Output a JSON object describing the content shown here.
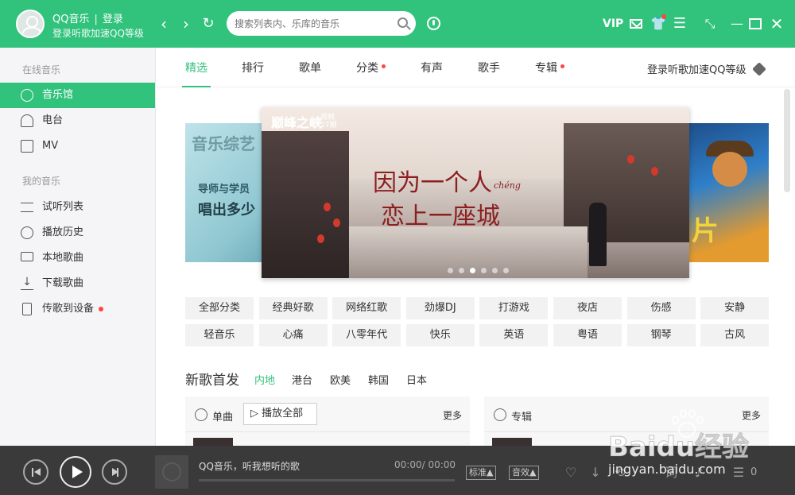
{
  "header": {
    "app_name": "QQ音乐",
    "separator": "|",
    "login_label": "登录",
    "sub_text": "登录听歌加速QQ等级",
    "back_glyph": "‹",
    "forward_glyph": "›",
    "refresh_glyph": "↻",
    "search_placeholder": "搜索列表内、乐库的音乐",
    "vip_label": "VIP",
    "menu_glyph": "☰",
    "mini_glyph": "⤡",
    "minimize_glyph": "—",
    "close_glyph": "✕",
    "accent_color": "#31c27c"
  },
  "sidebar": {
    "online_section": "在线音乐",
    "my_section": "我的音乐",
    "online_items": [
      {
        "label": "音乐馆",
        "icon": "music-hall-icon",
        "active": true
      },
      {
        "label": "电台",
        "icon": "radio-icon"
      },
      {
        "label": "MV",
        "icon": "mv-icon"
      }
    ],
    "my_items": [
      {
        "label": "试听列表",
        "icon": "playlist-icon"
      },
      {
        "label": "播放历史",
        "icon": "history-icon"
      },
      {
        "label": "本地歌曲",
        "icon": "computer-icon"
      },
      {
        "label": "下载歌曲",
        "icon": "download-icon"
      },
      {
        "label": "传歌到设备",
        "icon": "device-icon",
        "badge": true
      }
    ]
  },
  "tabs": {
    "items": [
      {
        "label": "精选",
        "active": true
      },
      {
        "label": "排行"
      },
      {
        "label": "歌单"
      },
      {
        "label": "分类",
        "badge": true
      },
      {
        "label": "有声"
      },
      {
        "label": "歌手"
      },
      {
        "label": "专辑",
        "badge": true
      }
    ],
    "login_prompt": "登录听歌加速QQ等级"
  },
  "banner": {
    "left_title": "音乐综艺",
    "left_line1": "导师与学员",
    "left_line2": "唱出多少",
    "main_logo": "巅峰之峡",
    "main_logo_sub1": "视频",
    "main_logo_sub2": "27期",
    "main_line1": "因为一个人",
    "main_cheng": "chéng",
    "main_line2": "恋上一座城",
    "right_text": "片",
    "dot_count": 6,
    "active_dot": 2
  },
  "categories": {
    "row1": [
      "全部分类",
      "经典好歌",
      "网络红歌",
      "劲爆DJ",
      "打游戏",
      "夜店",
      "伤感",
      "安静"
    ],
    "row2": [
      "轻音乐",
      "心痛",
      "八零年代",
      "快乐",
      "英语",
      "粤语",
      "钢琴",
      "古风"
    ]
  },
  "new_songs": {
    "title": "新歌首发",
    "regions": [
      {
        "label": "内地",
        "active": true
      },
      {
        "label": "港台"
      },
      {
        "label": "欧美"
      },
      {
        "label": "韩国"
      },
      {
        "label": "日本"
      }
    ],
    "single_label": "单曲",
    "play_all_label": "▷ 播放全部",
    "more_label": "更多",
    "album_label": "专辑"
  },
  "player": {
    "song_text": "QQ音乐，听我想听的歌",
    "time_current": "00:00",
    "time_sep": "/",
    "time_total": "00:00",
    "progress": 0,
    "quality_label": "标准▲",
    "effect_label": "音效▲",
    "playlist_count": "0"
  },
  "watermark": {
    "brand": "Baidu经验",
    "url": "jingyan.baidu.com"
  }
}
